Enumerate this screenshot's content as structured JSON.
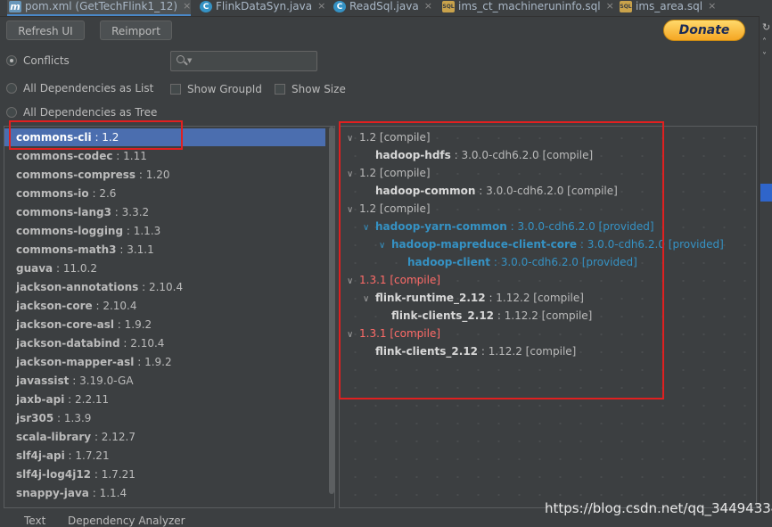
{
  "tabs": [
    {
      "label": "pom.xml (GetTechFlink1_12)",
      "icon": "m",
      "active": true
    },
    {
      "label": "FlinkDataSyn.java",
      "icon": "C",
      "active": false
    },
    {
      "label": "ReadSql.java",
      "icon": "C",
      "active": false
    },
    {
      "label": "ims_ct_machineruninfo.sql",
      "icon": "SQL",
      "active": false
    },
    {
      "label": "ims_area.sql",
      "icon": "SQL",
      "active": false
    }
  ],
  "toolbar": {
    "refresh_label": "Refresh UI",
    "reimport_label": "Reimport",
    "donate_label": "Donate"
  },
  "modes": {
    "conflicts": "Conflicts",
    "as_list": "All Dependencies as List",
    "as_tree": "All Dependencies as Tree",
    "show_group_id": "Show GroupId",
    "show_size": "Show Size",
    "selected": "Conflicts"
  },
  "search": {
    "value": ""
  },
  "list": [
    {
      "name": "commons-cli",
      "version": "1.2"
    },
    {
      "name": "commons-codec",
      "version": "1.11"
    },
    {
      "name": "commons-compress",
      "version": "1.20"
    },
    {
      "name": "commons-io",
      "version": "2.6"
    },
    {
      "name": "commons-lang3",
      "version": "3.3.2"
    },
    {
      "name": "commons-logging",
      "version": "1.1.3"
    },
    {
      "name": "commons-math3",
      "version": "3.1.1"
    },
    {
      "name": "guava",
      "version": "11.0.2"
    },
    {
      "name": "jackson-annotations",
      "version": "2.10.4"
    },
    {
      "name": "jackson-core",
      "version": "2.10.4"
    },
    {
      "name": "jackson-core-asl",
      "version": "1.9.2"
    },
    {
      "name": "jackson-databind",
      "version": "2.10.4"
    },
    {
      "name": "jackson-mapper-asl",
      "version": "1.9.2"
    },
    {
      "name": "javassist",
      "version": "3.19.0-GA"
    },
    {
      "name": "jaxb-api",
      "version": "2.2.11"
    },
    {
      "name": "jsr305",
      "version": "1.3.9"
    },
    {
      "name": "scala-library",
      "version": "2.12.7"
    },
    {
      "name": "slf4j-api",
      "version": "1.7.21"
    },
    {
      "name": "slf4j-log4j12",
      "version": "1.7.21"
    },
    {
      "name": "snappy-java",
      "version": "1.1.4"
    }
  ],
  "tree": [
    {
      "level": 0,
      "expanded": true,
      "name": "",
      "text": "1.2 [compile]",
      "style": "normal"
    },
    {
      "level": 1,
      "expanded": null,
      "name": "hadoop-hdfs",
      "text": " : 3.0.0-cdh6.2.0 [compile]",
      "style": "normal"
    },
    {
      "level": 0,
      "expanded": true,
      "name": "",
      "text": "1.2 [compile]",
      "style": "normal"
    },
    {
      "level": 1,
      "expanded": null,
      "name": "hadoop-common",
      "text": " : 3.0.0-cdh6.2.0 [compile]",
      "style": "normal"
    },
    {
      "level": 0,
      "expanded": true,
      "name": "",
      "text": "1.2 [compile]",
      "style": "normal"
    },
    {
      "level": 1,
      "expanded": true,
      "name": "hadoop-yarn-common",
      "text": " : 3.0.0-cdh6.2.0 [provided]",
      "style": "blue"
    },
    {
      "level": 2,
      "expanded": true,
      "name": "hadoop-mapreduce-client-core",
      "text": " : 3.0.0-cdh6.2.0 [provided]",
      "style": "blue"
    },
    {
      "level": 3,
      "expanded": null,
      "name": "hadoop-client",
      "text": " : 3.0.0-cdh6.2.0 [provided]",
      "style": "blue"
    },
    {
      "level": 0,
      "expanded": true,
      "name": "",
      "text": "1.3.1 [compile]",
      "style": "red"
    },
    {
      "level": 1,
      "expanded": true,
      "name": "flink-runtime_2.12",
      "text": " : 1.12.2 [compile]",
      "style": "normal"
    },
    {
      "level": 2,
      "expanded": null,
      "name": "flink-clients_2.12",
      "text": " : 1.12.2 [compile]",
      "style": "normal"
    },
    {
      "level": 0,
      "expanded": true,
      "name": "",
      "text": "1.3.1 [compile]",
      "style": "red"
    },
    {
      "level": 1,
      "expanded": null,
      "name": "flink-clients_2.12",
      "text": " : 1.12.2 [compile]",
      "style": "normal"
    }
  ],
  "bottom_tabs": [
    "Text",
    "Dependency Analyzer"
  ],
  "watermark": "https://blog.csdn.net/qq_34494334",
  "colors": {
    "selection": "#4b6eaf",
    "conflict": "#ff6b68",
    "provided": "#3592c4",
    "annotation_box": "#e02020"
  }
}
